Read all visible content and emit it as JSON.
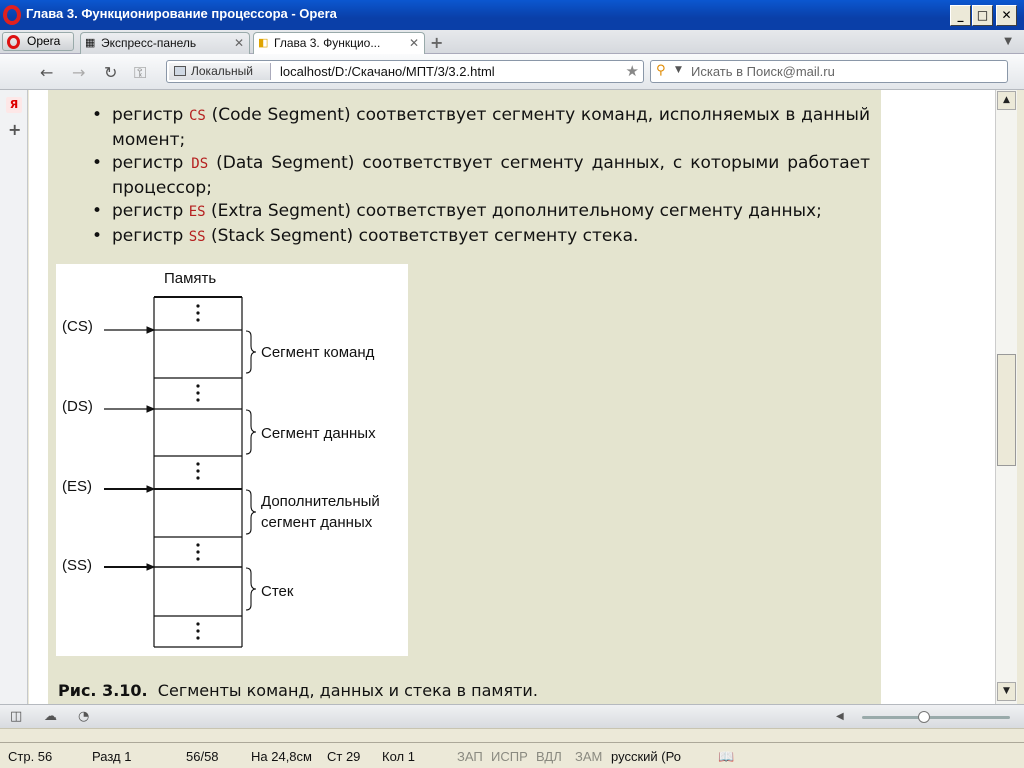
{
  "window": {
    "title": "Глава 3. Функционирование процессора - Opera"
  },
  "tabs": {
    "menu_label": "Opera",
    "items": [
      {
        "label": "Экспресс-панель"
      },
      {
        "label": "Глава 3. Функцио..."
      }
    ]
  },
  "address": {
    "badge": "Локальный",
    "url": "localhost/D:/Скачано/МПТ/3/3.2.html"
  },
  "search": {
    "placeholder": "Искать в Поиск@mail.ru"
  },
  "content": {
    "bullets": [
      {
        "pre": "регистр",
        "reg": "CS",
        "post": "(Code Segment) соответствует сегменту команд, исполняемых в данный момент;"
      },
      {
        "pre": "регистр",
        "reg": "DS",
        "post": "(Data Segment) соответствует сегменту данных, с которыми работает процессор;"
      },
      {
        "pre": "регистр",
        "reg": "ES",
        "post": "(Extra Segment) соответствует дополнительному сегменту данных;"
      },
      {
        "pre": "регистр",
        "reg": "SS",
        "post": "(Stack Segment) соответствует сегменту стека."
      }
    ],
    "figure": {
      "memory_label": "Память",
      "registers": [
        "(CS)",
        "(DS)",
        "(ES)",
        "(SS)"
      ],
      "segments": [
        "Сегмент команд",
        "Сегмент данных",
        "Дополнительный сегмент данных",
        "Стек"
      ],
      "segment_lines": [
        [
          "Сегмент команд"
        ],
        [
          "Сегмент данных"
        ],
        [
          "Дополнительный",
          "сегмент данных"
        ],
        [
          "Стек"
        ]
      ]
    },
    "caption": {
      "label": "Рис. 3.10.",
      "text": "Сегменты команд, данных и стека в памяти."
    }
  },
  "word_status": {
    "page": "Стр. 56",
    "section": "Разд 1",
    "pages": "56/58",
    "position": "На 24,8см",
    "line": "Ст 29",
    "column": "Кол 1",
    "rec": "ЗАП",
    "trk": "ИСПР",
    "ext": "ВДЛ",
    "ovr": "ЗАМ",
    "language": "русский (Ро"
  }
}
